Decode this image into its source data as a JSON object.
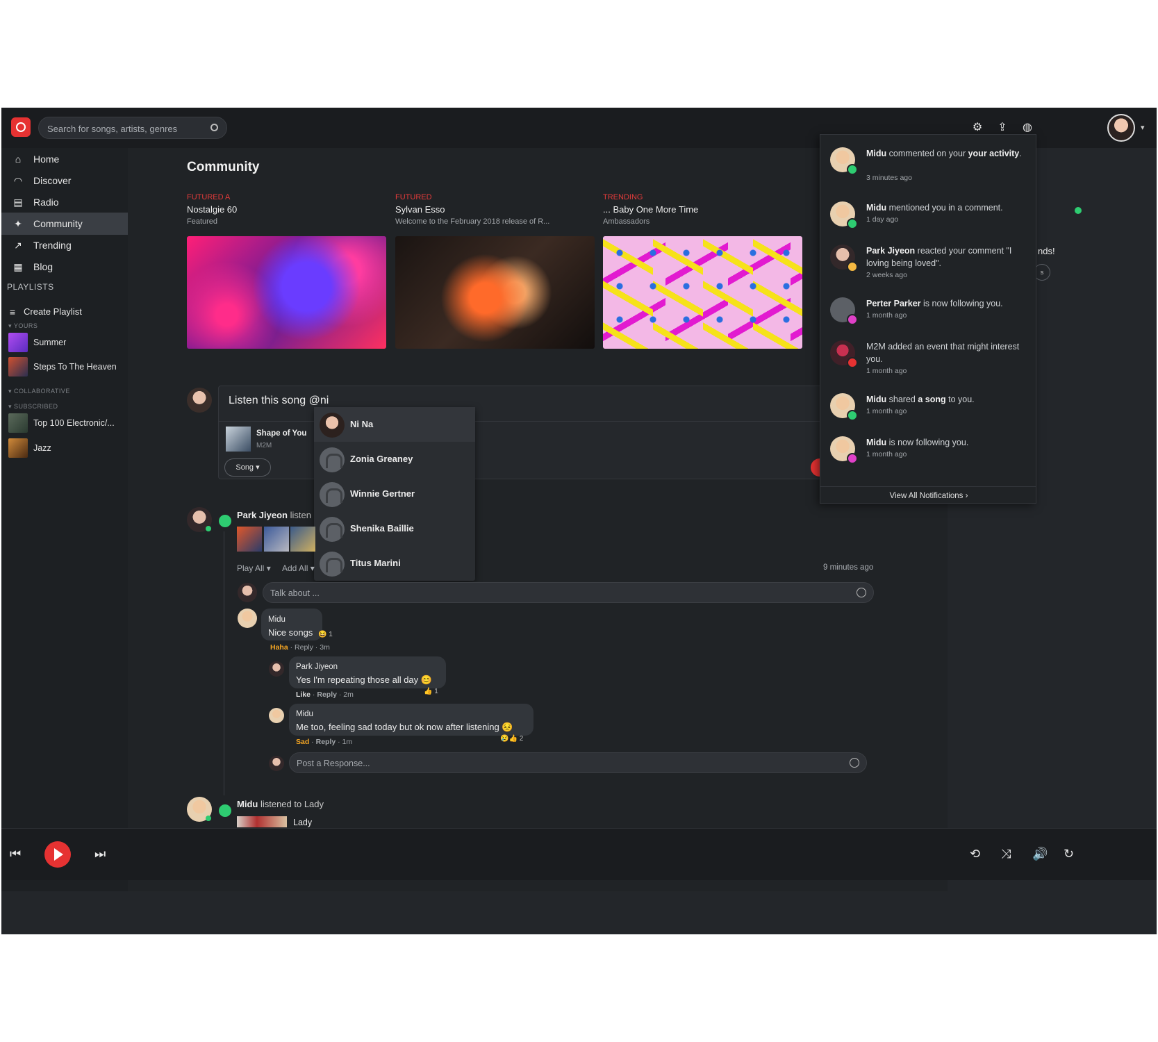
{
  "search": {
    "placeholder": "Search for songs, artists, genres"
  },
  "nav": {
    "items": [
      {
        "label": "Home",
        "icon": "home-icon"
      },
      {
        "label": "Discover",
        "icon": "discover-icon"
      },
      {
        "label": "Radio",
        "icon": "radio-icon"
      },
      {
        "label": "Community",
        "icon": "megaphone-icon",
        "active": true
      },
      {
        "label": "Trending",
        "icon": "trending-icon"
      },
      {
        "label": "Blog",
        "icon": "blog-icon"
      }
    ],
    "playlists_label": "PLAYLISTS",
    "create_label": "Create Playlist",
    "yours_label": "YOURS",
    "collaborative_label": "COLLABORATIVE",
    "subscribed_label": "SUBSCRIBED",
    "yours": [
      "Summer",
      "Steps To The Heaven"
    ],
    "subscribed": [
      "Top 100 Electronic/...",
      "Jazz"
    ]
  },
  "page": {
    "title": "Community"
  },
  "cards": [
    {
      "tag": "FUTURED A",
      "title": "Nostalgie 60",
      "sub": "Featured"
    },
    {
      "tag": "FUTURED",
      "title": "Sylvan Esso",
      "sub": "Welcome to the February 2018 release of R..."
    },
    {
      "tag": "TRENDING",
      "title": "... Baby One More Time",
      "sub": "Ambassadors"
    }
  ],
  "compose": {
    "text": "Listen this song @ni",
    "song_title": "Shape of You",
    "song_artist": "M2M",
    "song_button": "Song"
  },
  "mention": {
    "items": [
      "Ni Na",
      "Zonia Greaney",
      "Winnie Gertner",
      "Shenika Baillie",
      "Titus Marini"
    ]
  },
  "feed": {
    "post1": {
      "user": "Park Jiyeon",
      "action": "listen",
      "play_all": "Play All",
      "add_all": "Add All",
      "time": "9 minutes ago",
      "talk_placeholder": "Talk about ..."
    },
    "comments": [
      {
        "name": "Midu",
        "text": "Nice songs",
        "reaction_count": "1",
        "meta_react": "Haha",
        "reply": "Reply",
        "time": "3m"
      },
      {
        "name": "Park Jiyeon",
        "text": "Yes I'm repeating those all day",
        "reaction_count": "1",
        "meta_react": "Like",
        "reply": "Reply",
        "time": "2m"
      },
      {
        "name": "Midu",
        "text": "Me too, feeling sad today but ok now after listening",
        "reaction_count": "2",
        "meta_react": "Sad",
        "reply": "Reply",
        "time": "1m"
      }
    ],
    "response_placeholder": "Post a Response...",
    "post2": {
      "user": "Midu",
      "action": "listened to Lady",
      "song": "Lady"
    }
  },
  "right_peek": {
    "text": "nds!",
    "btn": "s"
  },
  "notifications": {
    "items": [
      {
        "html_bold": "Midu",
        "text": " commented on your ",
        "bold2": "your activity",
        "tail": ".",
        "time": "3 minutes ago",
        "badge_color": "#2ecc71"
      },
      {
        "html_bold": "Midu",
        "text": " mentioned you in a comment.",
        "bold2": "",
        "tail": "",
        "time": "1 day ago",
        "badge_color": "#2ecc71"
      },
      {
        "html_bold": "Park Jiyeon",
        "text": " reacted your comment \"I loving being loved\".",
        "bold2": "",
        "tail": "",
        "time": "2 weeks ago",
        "badge_color": "#f5b942"
      },
      {
        "html_bold": "Perter Parker",
        "text": " is now following you.",
        "bold2": "",
        "tail": "",
        "time": "1 month ago",
        "badge_color": "#e040c8"
      },
      {
        "html_bold": "",
        "text": "M2M added an event that might interest you.",
        "bold2": "",
        "tail": "",
        "time": "1 month ago",
        "badge_color": "#e63232"
      },
      {
        "html_bold": "Midu",
        "text": " shared ",
        "bold2": "a song",
        "tail": " to you.",
        "time": "1 month ago",
        "badge_color": "#2ecc71"
      },
      {
        "html_bold": "Midu",
        "text": " is now following you.",
        "bold2": "",
        "tail": "",
        "time": "1 month ago",
        "badge_color": "#e040c8"
      }
    ],
    "view_all": "View All Notifications ›"
  },
  "colors": {
    "accent": "#e63232",
    "online": "#2ecc71",
    "background": "#23262a"
  }
}
